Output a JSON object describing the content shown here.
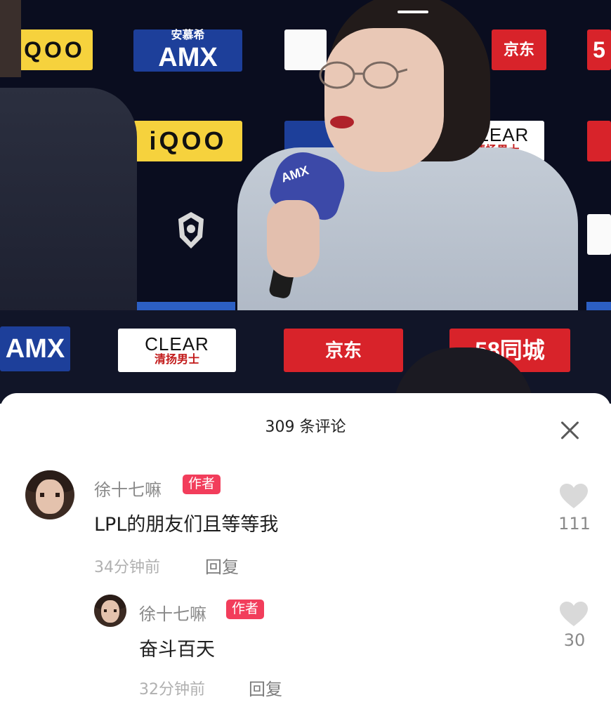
{
  "video": {
    "sponsors": {
      "iqoo": "iQOO",
      "amx_cn": "安慕希",
      "amx": "AMX",
      "jd": "京东",
      "clear": "CLEAR",
      "clear_cn": "清扬男士",
      "tongcheng": "58同城",
      "five": "5"
    }
  },
  "comments_panel": {
    "title": "309 条评论",
    "close_icon": "close-icon",
    "comments": [
      {
        "username": "徐十七嘛",
        "badge": "作者",
        "text": "LPL的朋友们且等等我",
        "time": "34分钟前",
        "reply_label": "回复",
        "likes": "111"
      },
      {
        "username": "徐十七嘛",
        "badge": "作者",
        "text": "奋斗百天",
        "time": "32分钟前",
        "reply_label": "回复",
        "likes": "30"
      }
    ],
    "colors": {
      "badge": "#f23d5b",
      "like_heart": "#d9d9d9"
    }
  }
}
